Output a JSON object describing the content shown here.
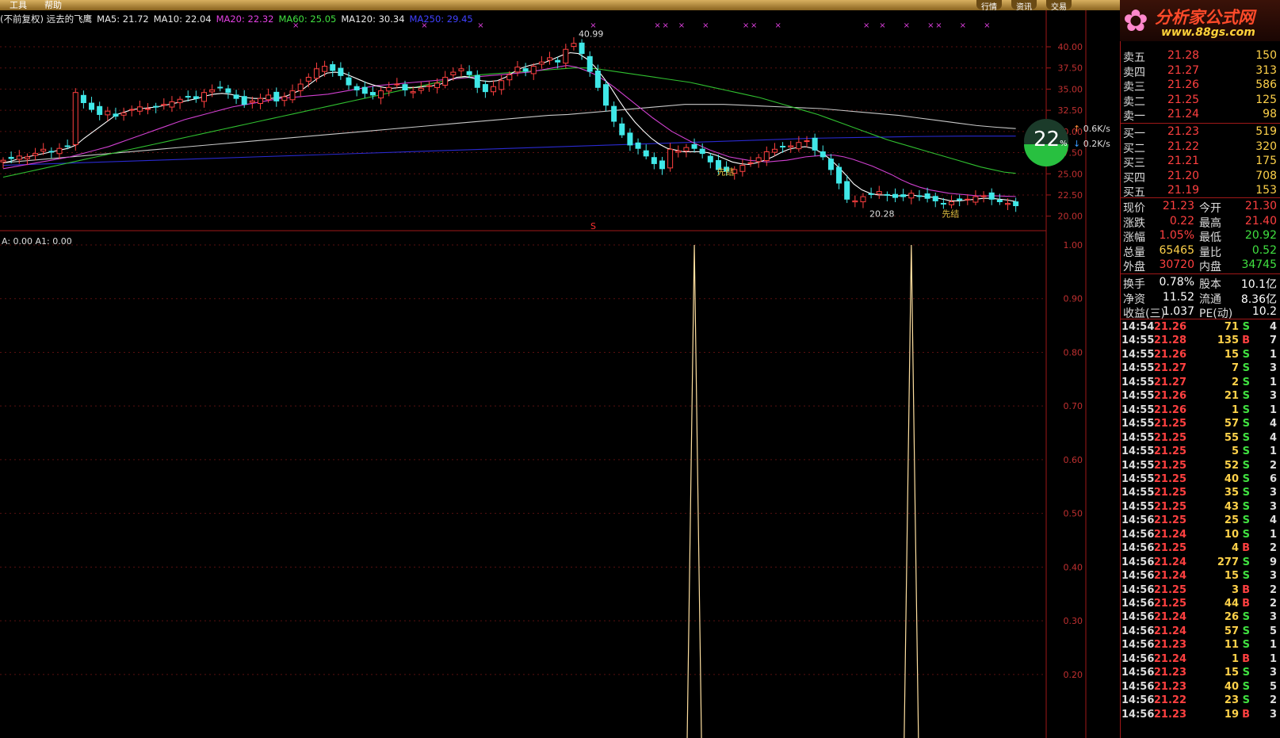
{
  "menu": {
    "tools": "工具",
    "help": "帮助"
  },
  "top_tabs": [
    "行情",
    "资讯",
    "交易"
  ],
  "legend": [
    {
      "text": "(不前复权) 远去的飞鹰",
      "color": "#e8e8e8"
    },
    {
      "text": "MA5: 21.72",
      "color": "#e8e8e8"
    },
    {
      "text": "MA10: 22.04",
      "color": "#e8e8e8"
    },
    {
      "text": "MA20: 22.32",
      "color": "#e040e0"
    },
    {
      "text": "MA60: 25.05",
      "color": "#40e040"
    },
    {
      "text": "MA120: 30.34",
      "color": "#e8e8e8"
    },
    {
      "text": "MA250: 29.45",
      "color": "#4040ff"
    }
  ],
  "indicator_legend": "A: 0.00  A1: 0.00",
  "logo": {
    "title": "分析家公式网",
    "url": "www.88gs.com"
  },
  "annotations": {
    "high": "40.99",
    "low": "20.28",
    "sig1": "先结",
    "sig2": "先结",
    "marker": "S"
  },
  "price_axis": [
    "40.00",
    "37.50",
    "35.00",
    "32.50",
    "30.00",
    "27.50",
    "25.00",
    "22.50",
    "20.00"
  ],
  "ind_axis": [
    "1.00",
    "0.90",
    "0.80",
    "0.70",
    "0.60",
    "0.50",
    "0.40",
    "0.30",
    "0.20"
  ],
  "speed": {
    "percent": "22",
    "unit": "%",
    "up": "0.6K/s",
    "down": "0.2K/s"
  },
  "quote": {
    "sells": [
      {
        "label": "卖五",
        "price": "21.28",
        "vol": "150"
      },
      {
        "label": "卖四",
        "price": "21.27",
        "vol": "313"
      },
      {
        "label": "卖三",
        "price": "21.26",
        "vol": "586"
      },
      {
        "label": "卖二",
        "price": "21.25",
        "vol": "125"
      },
      {
        "label": "卖一",
        "price": "21.24",
        "vol": "98"
      }
    ],
    "buys": [
      {
        "label": "买一",
        "price": "21.23",
        "vol": "519"
      },
      {
        "label": "买二",
        "price": "21.22",
        "vol": "320"
      },
      {
        "label": "买三",
        "price": "21.21",
        "vol": "175"
      },
      {
        "label": "买四",
        "price": "21.20",
        "vol": "708"
      },
      {
        "label": "买五",
        "price": "21.19",
        "vol": "153"
      }
    ],
    "stats": [
      {
        "l1": "现价",
        "v1": "21.23",
        "c1": "#ff4040",
        "l2": "今开",
        "v2": "21.30",
        "c2": "#ff4040"
      },
      {
        "l1": "涨跌",
        "v1": "0.22",
        "c1": "#ff4040",
        "l2": "最高",
        "v2": "21.40",
        "c2": "#ff4040"
      },
      {
        "l1": "涨幅",
        "v1": "1.05%",
        "c1": "#ff4040",
        "l2": "最低",
        "v2": "20.92",
        "c2": "#40e040"
      },
      {
        "l1": "总量",
        "v1": "65465",
        "c1": "#ffd24a",
        "l2": "量比",
        "v2": "0.52",
        "c2": "#40e040"
      },
      {
        "l1": "外盘",
        "v1": "30720",
        "c1": "#ff4040",
        "l2": "内盘",
        "v2": "34745",
        "c2": "#40e040"
      }
    ],
    "info": [
      {
        "l1": "换手",
        "v1": "0.78%",
        "l2": "股本",
        "v2": "10.1亿"
      },
      {
        "l1": "净资",
        "v1": "11.52",
        "l2": "流通",
        "v2": "8.36亿"
      },
      {
        "l1": "收益(三)",
        "v1": "1.037",
        "l2": "PE(动)",
        "v2": "10.2"
      }
    ]
  },
  "ticks": [
    [
      "14:54",
      "21.26",
      "71",
      "S",
      "4"
    ],
    [
      "14:55",
      "21.28",
      "135",
      "B",
      "7"
    ],
    [
      "14:55",
      "21.26",
      "15",
      "S",
      "1"
    ],
    [
      "14:55",
      "21.27",
      "7",
      "S",
      "3"
    ],
    [
      "14:55",
      "21.27",
      "2",
      "S",
      "1"
    ],
    [
      "14:55",
      "21.26",
      "21",
      "S",
      "3"
    ],
    [
      "14:55",
      "21.26",
      "1",
      "S",
      "1"
    ],
    [
      "14:55",
      "21.25",
      "57",
      "S",
      "4"
    ],
    [
      "14:55",
      "21.25",
      "55",
      "S",
      "4"
    ],
    [
      "14:55",
      "21.25",
      "5",
      "S",
      "1"
    ],
    [
      "14:55",
      "21.25",
      "52",
      "S",
      "2"
    ],
    [
      "14:55",
      "21.25",
      "40",
      "S",
      "6"
    ],
    [
      "14:55",
      "21.25",
      "35",
      "S",
      "3"
    ],
    [
      "14:55",
      "21.25",
      "43",
      "S",
      "3"
    ],
    [
      "14:56",
      "21.25",
      "25",
      "S",
      "4"
    ],
    [
      "14:56",
      "21.24",
      "10",
      "S",
      "1"
    ],
    [
      "14:56",
      "21.25",
      "4",
      "B",
      "2"
    ],
    [
      "14:56",
      "21.24",
      "277",
      "S",
      "9"
    ],
    [
      "14:56",
      "21.24",
      "15",
      "S",
      "3"
    ],
    [
      "14:56",
      "21.25",
      "3",
      "B",
      "2"
    ],
    [
      "14:56",
      "21.25",
      "44",
      "B",
      "2"
    ],
    [
      "14:56",
      "21.24",
      "26",
      "S",
      "3"
    ],
    [
      "14:56",
      "21.24",
      "57",
      "S",
      "5"
    ],
    [
      "14:56",
      "21.23",
      "11",
      "S",
      "1"
    ],
    [
      "14:56",
      "21.24",
      "1",
      "B",
      "1"
    ],
    [
      "14:56",
      "21.23",
      "15",
      "S",
      "3"
    ],
    [
      "14:56",
      "21.23",
      "40",
      "S",
      "5"
    ],
    [
      "14:56",
      "21.22",
      "23",
      "S",
      "2"
    ],
    [
      "14:56",
      "21.23",
      "19",
      "B",
      "3"
    ]
  ],
  "chart_data": {
    "type": "line",
    "title": "",
    "price_range": [
      19.5,
      41.5
    ],
    "closes": [
      26.6,
      26.8,
      27.1,
      27.0,
      27.4,
      27.9,
      27.6,
      28.0,
      28.3,
      34.6,
      33.4,
      32.6,
      32.0,
      32.4,
      31.8,
      32.2,
      32.6,
      32.9,
      32.7,
      32.9,
      33.2,
      33.5,
      33.8,
      34.1,
      33.9,
      34.6,
      34.9,
      35.2,
      34.6,
      33.9,
      33.2,
      33.6,
      33.9,
      34.3,
      33.6,
      34.1,
      34.8,
      35.6,
      36.4,
      37.4,
      37.7,
      37.2,
      36.6,
      35.5,
      34.9,
      34.5,
      34.3,
      34.8,
      35.2,
      35.6,
      34.9,
      34.7,
      35.1,
      35.4,
      35.7,
      36.4,
      37.0,
      37.4,
      36.7,
      35.2,
      34.7,
      35.3,
      36.0,
      36.7,
      37.6,
      37.1,
      37.7,
      38.2,
      38.7,
      38.2,
      39.7,
      40.4,
      39.2,
      37.1,
      35.2,
      33.1,
      31.2,
      29.6,
      28.4,
      28.0,
      27.1,
      26.2,
      25.6,
      27.9,
      27.7,
      28.1,
      28.0,
      27.4,
      26.4,
      25.5,
      25.3,
      25.5,
      26.0,
      26.3,
      26.9,
      27.6,
      27.9,
      28.2,
      28.3,
      28.7,
      28.9,
      27.8,
      27.0,
      25.5,
      23.9,
      22.0,
      21.8,
      22.3,
      22.6,
      22.9,
      22.5,
      22.2,
      22.3,
      22.7,
      22.4,
      22.1,
      21.8,
      21.5,
      21.7,
      21.9,
      22.0,
      22.3,
      22.4,
      22.0,
      21.7,
      21.5,
      21.23
    ],
    "ma5": [
      26.3,
      26.5,
      26.8,
      27.0,
      27.2,
      27.4,
      27.6,
      27.8,
      28.0,
      28.4,
      29.2,
      29.9,
      30.6,
      31.3,
      32.0,
      32.3,
      32.6,
      32.7,
      32.8,
      32.9,
      33.1,
      33.3,
      33.5,
      33.7,
      33.9,
      34.2,
      34.4,
      34.5,
      34.4,
      34.2,
      34.0,
      33.9,
      33.9,
      33.9,
      34.0,
      34.2,
      34.6,
      35.0,
      35.7,
      36.4,
      36.9,
      37.0,
      36.9,
      36.5,
      36.1,
      35.7,
      35.4,
      35.2,
      35.1,
      35.2,
      35.2,
      35.2,
      35.3,
      35.4,
      35.6,
      36.0,
      36.4,
      36.5,
      36.3,
      36.0,
      35.9,
      36.0,
      36.4,
      37.0,
      37.5,
      37.8,
      38.0,
      38.2,
      38.6,
      39.0,
      39.3,
      39.2,
      38.6,
      37.7,
      36.5,
      35.2,
      33.7,
      32.3,
      31.1,
      30.1,
      29.2,
      28.5,
      28.0,
      27.8,
      27.6,
      27.6,
      27.6,
      27.5,
      27.2,
      26.8,
      26.4,
      26.2,
      26.1,
      26.3,
      26.6,
      27.0,
      27.5,
      27.9,
      28.1,
      28.2,
      28.0,
      27.5,
      26.8,
      25.9,
      24.9,
      23.8,
      23.1,
      22.7,
      22.5,
      22.5,
      22.4,
      22.4,
      22.5,
      22.4,
      22.3,
      22.2,
      22.0,
      21.8,
      21.8,
      21.9,
      22.0,
      22.1,
      22.1,
      22.0,
      21.9,
      21.72
    ],
    "ma20": [
      25.6,
      25.8,
      26.0,
      26.2,
      26.4,
      26.6,
      26.8,
      27.0,
      27.3,
      27.6,
      27.9,
      28.2,
      28.6,
      29.0,
      29.4,
      29.8,
      30.2,
      30.6,
      31.0,
      31.4,
      31.7,
      32.0,
      32.3,
      32.6,
      32.9,
      33.1,
      33.3,
      33.5,
      33.7,
      33.9,
      34.0,
      34.1,
      34.2,
      34.3,
      34.4,
      34.6,
      34.8,
      35.0,
      35.2,
      35.4,
      35.5,
      35.6,
      35.7,
      35.8,
      35.9,
      36.0,
      36.1,
      36.2,
      36.3,
      36.4,
      36.5,
      36.6,
      36.7,
      36.8,
      36.9,
      37.0,
      37.2,
      37.4,
      37.6,
      37.8,
      37.6,
      37.2,
      36.7,
      36.0,
      35.2,
      34.3,
      33.4,
      32.5,
      31.6,
      30.8,
      30.0,
      29.4,
      28.8,
      28.3,
      27.8,
      27.4,
      27.0,
      26.8,
      26.6,
      26.5,
      26.4,
      26.5,
      26.6,
      26.8,
      27.0,
      27.1,
      27.2,
      27.2,
      27.0,
      26.7,
      26.3,
      25.9,
      25.4,
      24.9,
      24.3,
      23.8,
      23.4,
      23.1,
      22.9,
      22.7,
      22.6,
      22.5,
      22.4,
      22.4,
      22.4,
      22.35,
      22.32
    ],
    "ma60": [
      24.6,
      24.9,
      25.2,
      25.5,
      25.8,
      26.1,
      26.4,
      26.7,
      27.0,
      27.3,
      27.6,
      27.9,
      28.2,
      28.5,
      28.8,
      29.1,
      29.4,
      29.7,
      30.0,
      30.3,
      30.6,
      30.9,
      31.2,
      31.5,
      31.8,
      32.1,
      32.4,
      32.7,
      33.0,
      33.3,
      33.6,
      33.9,
      34.2,
      34.5,
      34.8,
      35.1,
      35.4,
      35.7,
      36.0,
      36.3,
      36.5,
      36.7,
      36.8,
      36.9,
      37.0,
      37.1,
      37.2,
      37.3,
      37.4,
      37.5,
      37.5,
      37.4,
      37.2,
      37.0,
      36.8,
      36.6,
      36.4,
      36.2,
      36.0,
      35.8,
      35.5,
      35.2,
      34.9,
      34.6,
      34.3,
      34.0,
      33.6,
      33.2,
      32.8,
      32.4,
      32.0,
      31.5,
      31.0,
      30.5,
      30.0,
      29.5,
      29.0,
      28.6,
      28.2,
      27.8,
      27.4,
      27.0,
      26.6,
      26.2,
      25.8,
      25.5,
      25.2,
      25.05
    ],
    "ma120": [
      26.3,
      26.5,
      26.7,
      26.9,
      27.1,
      27.3,
      27.5,
      27.7,
      27.9,
      28.1,
      28.3,
      28.5,
      28.7,
      28.9,
      29.1,
      29.3,
      29.5,
      29.7,
      29.9,
      30.1,
      30.3,
      30.5,
      30.7,
      30.9,
      31.1,
      31.3,
      31.5,
      31.7,
      31.9,
      32.0,
      32.2,
      32.4,
      32.6,
      32.8,
      33.0,
      33.2,
      33.2,
      33.2,
      33.1,
      33.0,
      32.9,
      32.8,
      32.7,
      32.5,
      32.3,
      32.1,
      31.9,
      31.6,
      31.3,
      31.0,
      30.7,
      30.5,
      30.34
    ],
    "ma250": [
      26.0,
      26.2,
      26.4,
      26.6,
      26.8,
      27.0,
      27.2,
      27.4,
      27.6,
      27.8,
      28.0,
      28.2,
      28.4,
      28.6,
      28.8,
      29.0,
      29.2,
      29.3,
      29.4,
      29.45,
      29.45
    ],
    "indicator": {
      "name": "A",
      "spikes_at": [
        86,
        113
      ],
      "value": 0.0,
      "range": [
        0.15,
        1.05
      ]
    }
  }
}
